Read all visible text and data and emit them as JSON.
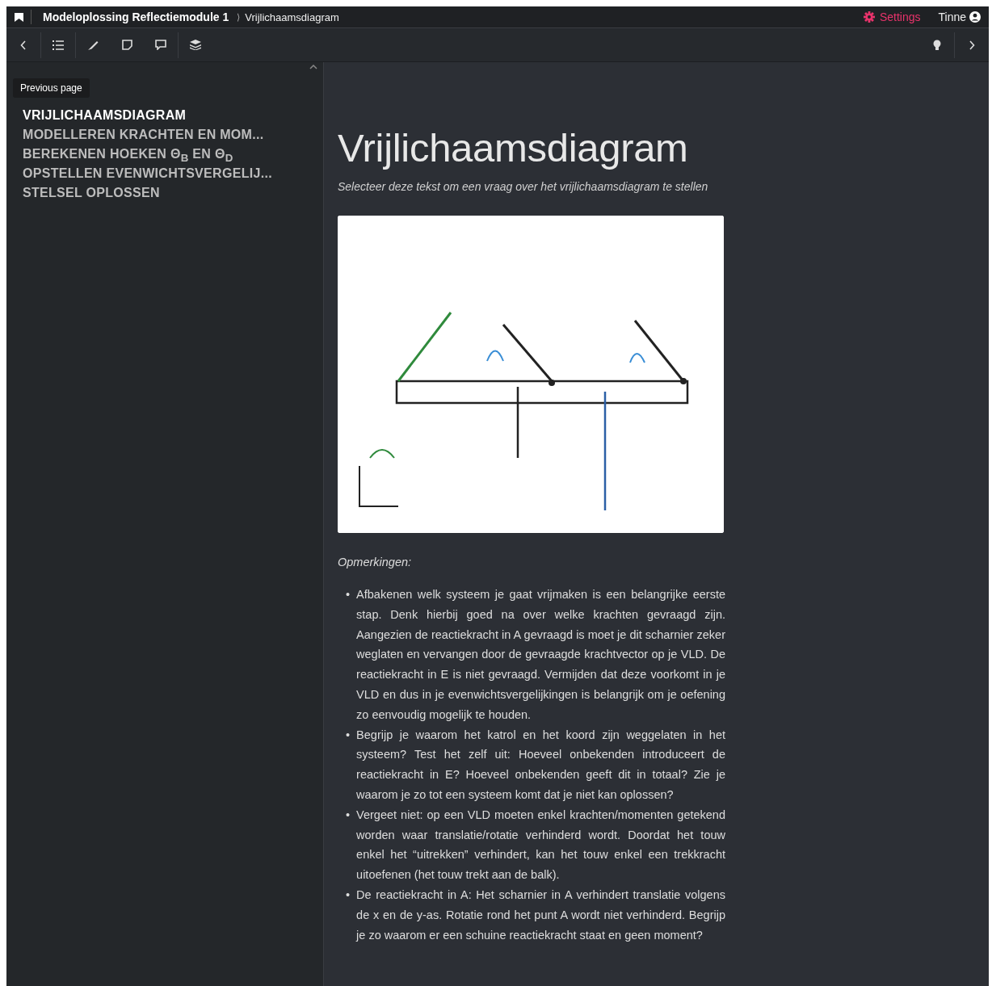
{
  "topbar": {
    "course": "Modeloplossing Reflectiemodule 1",
    "separator": "⟩",
    "page": "Vrijlichaamsdiagram",
    "settings": "Settings",
    "user": "Tinne"
  },
  "toolbar": {
    "tooltip": "Previous page"
  },
  "sidebar": {
    "items": [
      {
        "label": "VRIJLICHAAMSDIAGRAM",
        "selected": true
      },
      {
        "label": "MODELLEREN KRACHTEN EN MOM...",
        "selected": false
      },
      {
        "label": "BEREKENEN HOEKEN Θ$_{B}$ EN Θ$_{D}$",
        "selected": false
      },
      {
        "label": "OPSTELLEN EVENWICHTSVERGELIJ...",
        "selected": false
      },
      {
        "label": "STELSEL OPLOSSEN",
        "selected": false
      }
    ]
  },
  "content": {
    "title": "Vrijlichaamsdiagram",
    "subtitle": "Selecteer deze tekst om een vraag over het vrijlichaamsdiagram te stellen",
    "figure": {
      "kind": "picture"
    },
    "remarks_heading": "Opmerkingen:",
    "bullet": "•",
    "remarks": [
      "Afbakenen welk systeem je gaat vrijmaken is een belangrijke eerste stap. Denk hierbij goed na over welke krachten gevraagd zijn. Aangezien de reactiekracht in A gevraagd is moet je dit scharnier zeker weglaten en vervangen door de gevraagde krachtvector op je VLD. De reactiekracht in E is niet gevraagd. Vermijden dat deze voorkomt in je VLD en dus in je evenwichtsvergelijkingen is belangrijk om je oefening zo eenvoudig mogelijk te houden.",
      "Begrijp je waarom het katrol en het koord zijn weggelaten in het systeem? Test het zelf uit: Hoeveel onbekenden introduceert de reactiekracht in E? Hoeveel onbekenden geeft dit in totaal? Zie je waarom je zo tot een systeem komt dat je niet kan oplossen?",
      "Vergeet niet: op een VLD moeten enkel krachten/momenten getekend worden waar translatie/rotatie verhinderd wordt. Doordat het touw enkel het “uitrekken” verhindert, kan het touw enkel een trekkracht uitoefenen (het touw trekt aan de balk).",
      "De reactiekracht in A: Het scharnier in A verhindert translatie volgens de x en de y-as. Rotatie rond het punt A wordt niet verhinderd. Begrijp je zo waarom er een schuine reactiekracht staat en geen moment?"
    ]
  }
}
